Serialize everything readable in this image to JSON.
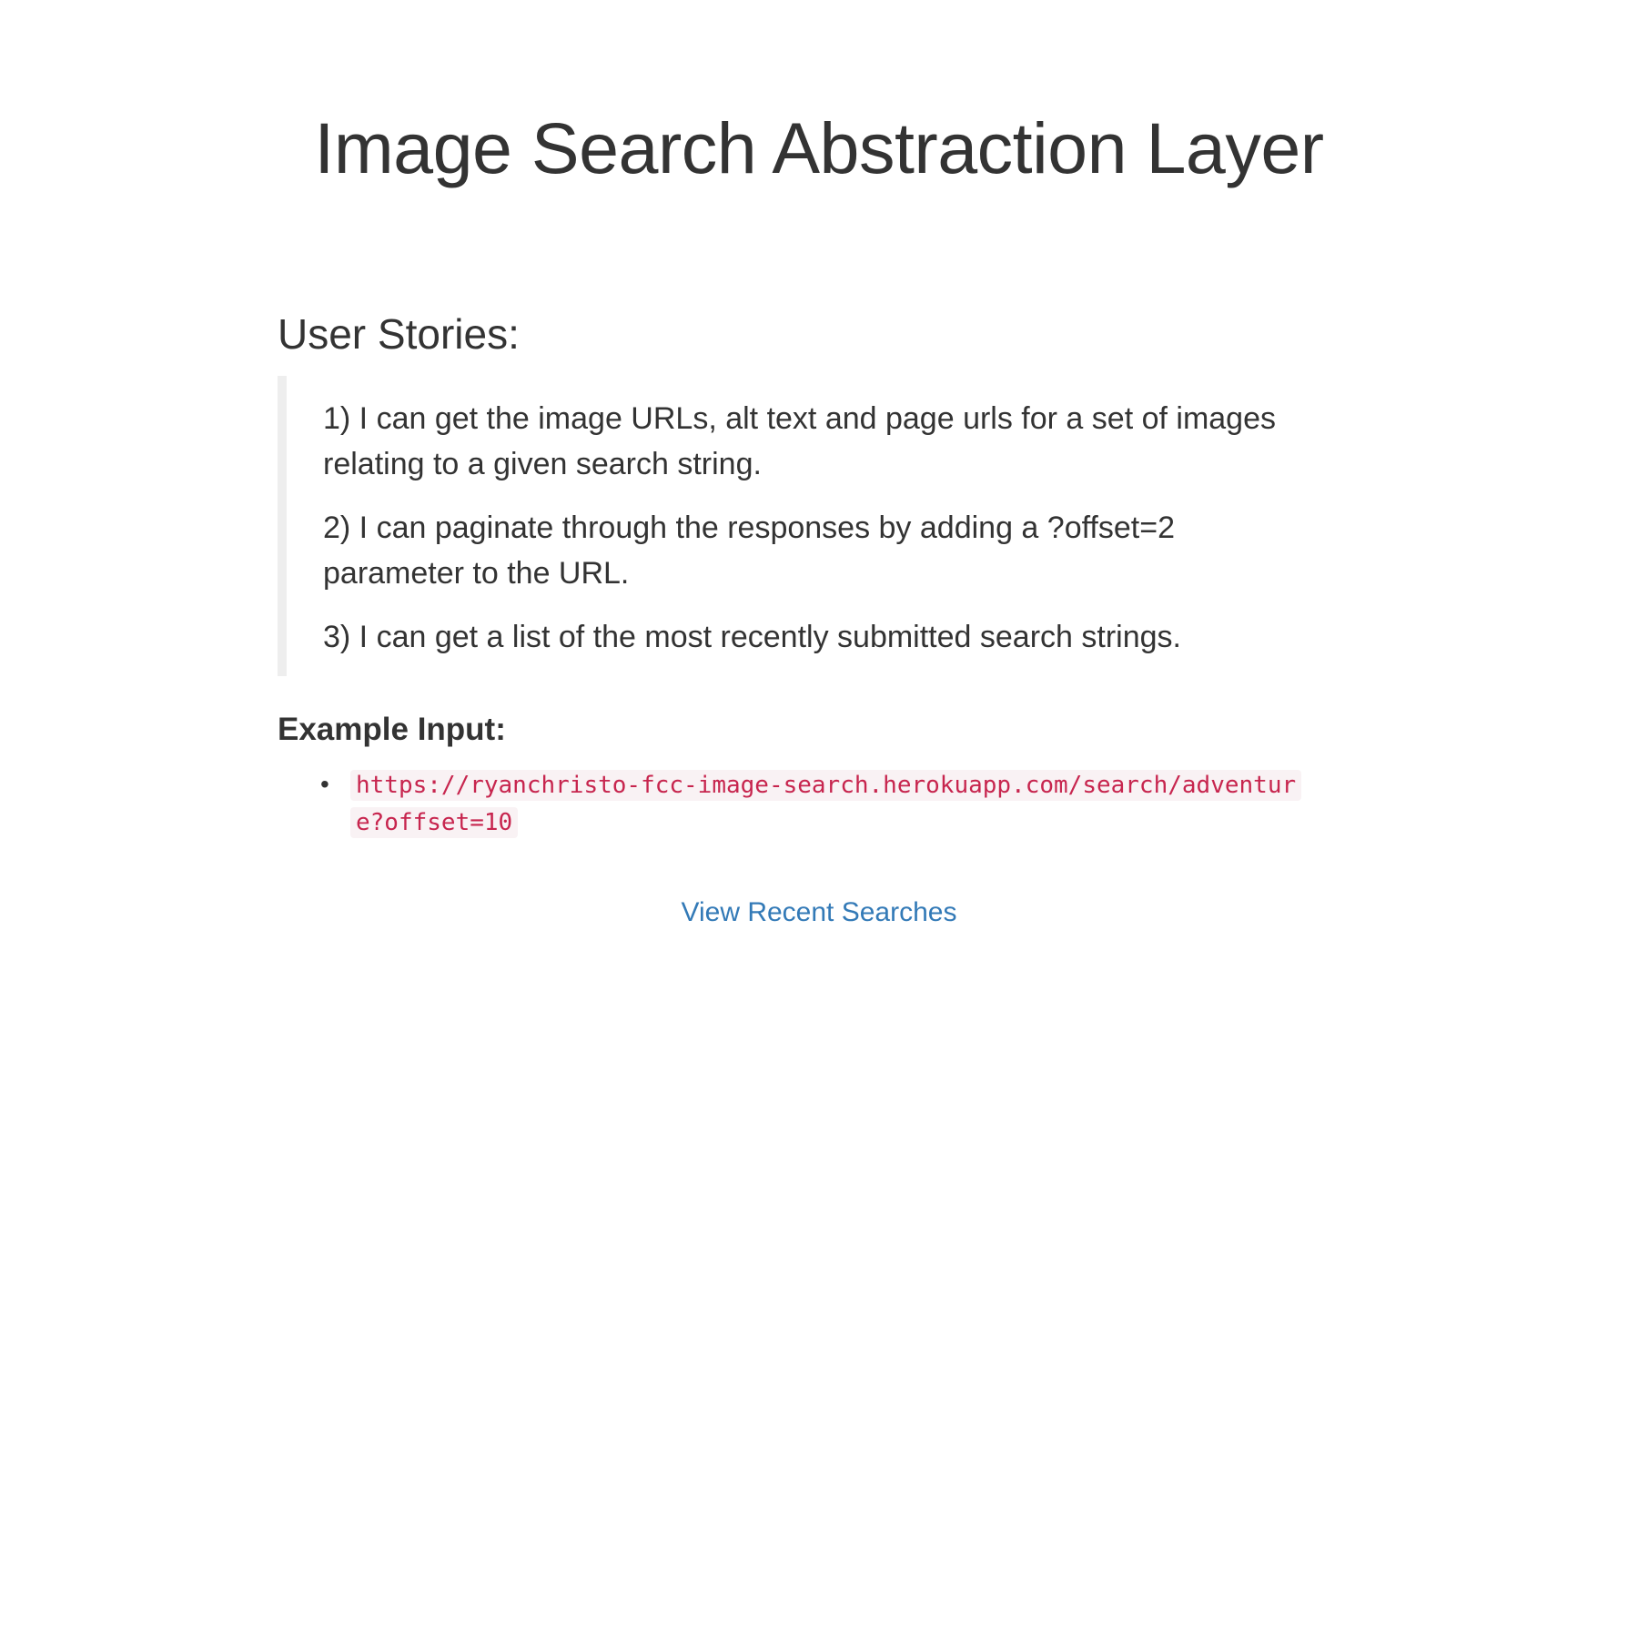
{
  "header": {
    "title": "Image Search Abstraction Layer"
  },
  "stories": {
    "heading": "User Stories:",
    "items": [
      "1) I can get the image URLs, alt text and page urls for a set of images relating to a given search string.",
      "2) I can paginate through the responses by adding a ?offset=2 parameter to the URL.",
      "3) I can get a list of the most recently submitted search strings."
    ]
  },
  "example": {
    "heading": "Example Input:",
    "bullet": "•",
    "items": [
      "https://ryanchristo-fcc-image-search.herokuapp.com/search/adventure?offset=10"
    ]
  },
  "links": {
    "recent_searches": "View Recent Searches"
  },
  "colors": {
    "text": "#333333",
    "link": "#337ab7",
    "code_text": "#c7254e",
    "code_background": "#f9f2f4",
    "blockquote_border": "#eeeeee"
  }
}
